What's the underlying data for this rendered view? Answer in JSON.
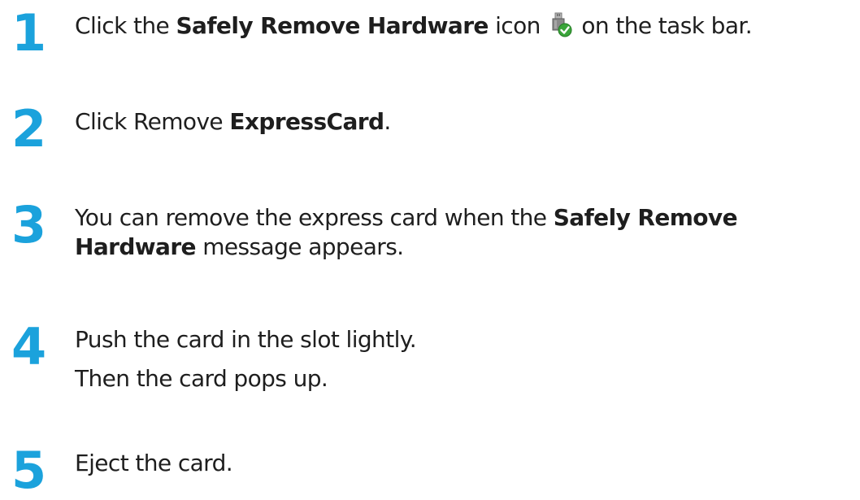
{
  "steps": [
    {
      "number": "1",
      "before": "Click the ",
      "bold": "Safely Remove Hardware",
      "middle": " icon ",
      "icon": "safely-remove-hardware-icon",
      "after": " on the task bar."
    },
    {
      "number": "2",
      "before": "Click Remove ",
      "bold": "ExpressCard",
      "after": "."
    },
    {
      "number": "3",
      "line1_before": "You can remove the express card when the ",
      "line1_bold": "Safely Remove",
      "line2_bold": "Hardware",
      "line2_after": " message appears."
    },
    {
      "number": "4",
      "line1": "Push the card in the slot lightly.",
      "line2": "Then the card pops up."
    },
    {
      "number": "5",
      "line1": "Eject the card."
    }
  ],
  "colors": {
    "step_number": "#1ba2dc",
    "text": "#1e1e1e",
    "icon_check": "#3aa53a"
  }
}
